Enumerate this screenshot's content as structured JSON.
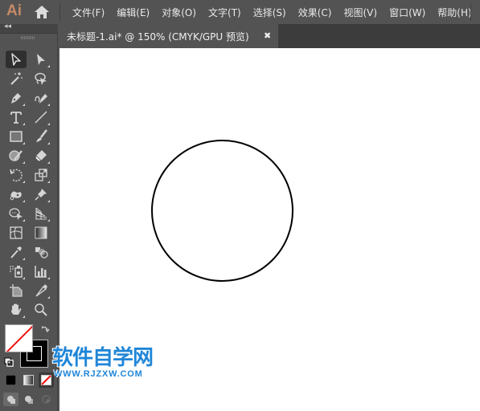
{
  "app": {
    "logo": "Ai",
    "home_icon": "home-icon"
  },
  "menu": {
    "items": [
      {
        "label": "文件(F)"
      },
      {
        "label": "编辑(E)"
      },
      {
        "label": "对象(O)"
      },
      {
        "label": "文字(T)"
      },
      {
        "label": "选择(S)"
      },
      {
        "label": "效果(C)"
      },
      {
        "label": "视图(V)"
      },
      {
        "label": "窗口(W)"
      },
      {
        "label": "帮助(H)"
      }
    ]
  },
  "toolbar": {
    "collapse_label": "◂◂",
    "tools": [
      {
        "name": "selection-tool",
        "active": true
      },
      {
        "name": "direct-selection-tool"
      },
      {
        "name": "magic-wand-tool"
      },
      {
        "name": "lasso-tool"
      },
      {
        "name": "pen-tool"
      },
      {
        "name": "curvature-tool"
      },
      {
        "name": "type-tool"
      },
      {
        "name": "line-segment-tool"
      },
      {
        "name": "rectangle-tool"
      },
      {
        "name": "paintbrush-tool"
      },
      {
        "name": "shaper-tool"
      },
      {
        "name": "eraser-tool"
      },
      {
        "name": "rotate-tool"
      },
      {
        "name": "scale-tool"
      },
      {
        "name": "puppet-warp-tool"
      },
      {
        "name": "pin-tool"
      },
      {
        "name": "shape-builder-tool"
      },
      {
        "name": "perspective-grid-tool"
      },
      {
        "name": "mesh-tool"
      },
      {
        "name": "gradient-tool"
      },
      {
        "name": "eyedropper-tool"
      },
      {
        "name": "blend-tool"
      },
      {
        "name": "symbol-sprayer-tool"
      },
      {
        "name": "column-graph-tool"
      },
      {
        "name": "artboard-tool"
      },
      {
        "name": "slice-tool"
      },
      {
        "name": "hand-tool"
      },
      {
        "name": "zoom-tool"
      }
    ],
    "fill": "none",
    "stroke": "#000000",
    "color_modes": [
      "color",
      "gradient",
      "none"
    ],
    "draw_modes": [
      "draw-normal",
      "draw-behind",
      "draw-inside"
    ]
  },
  "document": {
    "tab_title": "未标题-1.ai* @ 150% (CMYK/GPU 预览)",
    "close_label": "✖",
    "zoom": "150%",
    "color_mode": "CMYK/GPU 预览"
  },
  "artwork": {
    "shape": "ellipse",
    "fill": "none",
    "stroke": "#000000"
  },
  "watermark": {
    "title": "软件自学网",
    "url": "WWW.RJZXW.COM",
    "color": "#1f86d8"
  }
}
